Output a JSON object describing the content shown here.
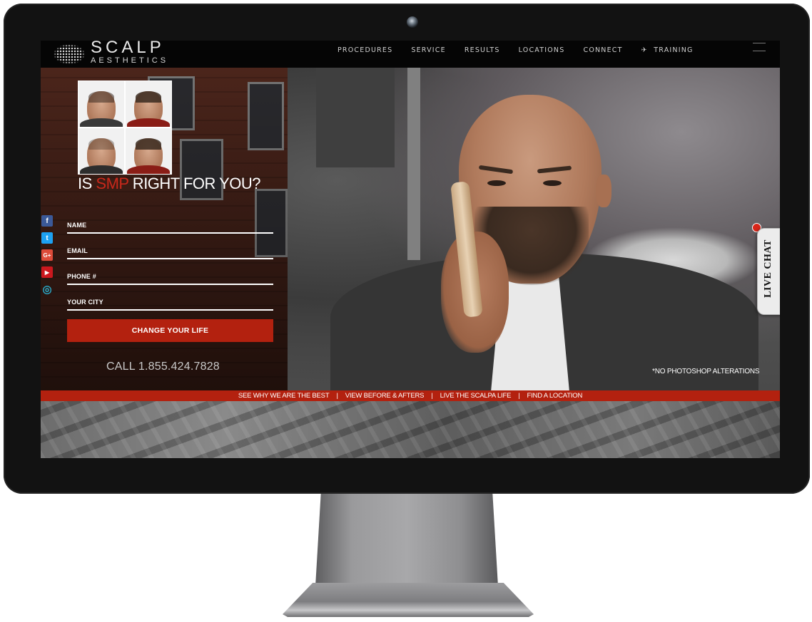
{
  "nav": {
    "logo_main": "SCALP",
    "logo_sub": "AESTHETICS",
    "items": [
      "PROCEDURES",
      "SERVICE",
      "RESULTS",
      "LOCATIONS",
      "CONNECT",
      "TRAINING"
    ],
    "training_icon": "graduation-cap-icon"
  },
  "hero": {
    "title_prefix": "IS ",
    "title_highlight": "SMP",
    "title_suffix": " RIGHT FOR YOU?",
    "form": {
      "fields": [
        "NAME",
        "EMAIL",
        "PHONE #",
        "YOUR CITY"
      ],
      "submit_label": "CHANGE YOUR LIFE"
    },
    "call_text": "CALL 1.855.424.7828",
    "disclaimer": "*NO PHOTOSHOP ALTERATIONS",
    "social": [
      {
        "icon": "facebook-icon",
        "glyph": "f",
        "color": "#3b5998"
      },
      {
        "icon": "twitter-icon",
        "glyph": "t",
        "color": "#1da1f2"
      },
      {
        "icon": "google-plus-icon",
        "glyph": "G+",
        "color": "#dd4b39"
      },
      {
        "icon": "youtube-icon",
        "glyph": "▶",
        "color": "#cc181e"
      },
      {
        "icon": "instagram-icon",
        "glyph": "◎",
        "color": "#2aa6c4"
      }
    ],
    "accent_color": "#b3210f"
  },
  "live_chat": {
    "label": "LIVE CHAT"
  },
  "bottom_links": [
    "SEE WHY WE ARE THE BEST",
    "VIEW BEFORE & AFTERS",
    "LIVE THE SCALPA LIFE",
    "FIND A LOCATION"
  ],
  "bottom_separator": "|"
}
